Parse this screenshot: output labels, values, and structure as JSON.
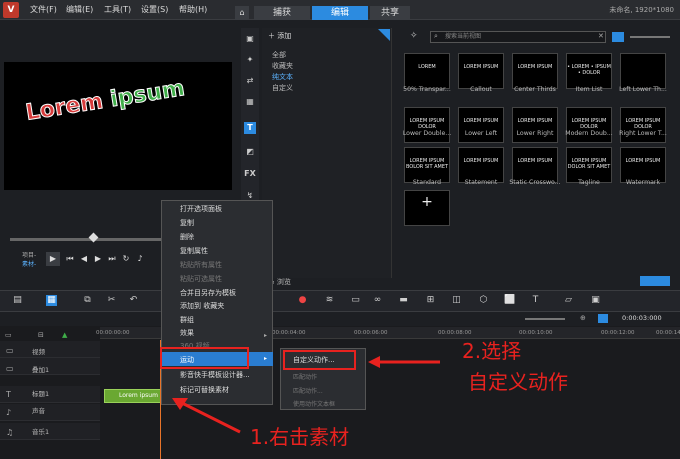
{
  "menubar": {
    "items": [
      "文件(F)",
      "编辑(E)",
      "工具(T)",
      "设置(S)",
      "帮助(H)"
    ]
  },
  "tabs": [
    "捕获",
    "编辑",
    "共享"
  ],
  "project_info": "未命名, 1920*1080",
  "preview": {
    "words": [
      "Lorem",
      " ",
      "ipsum"
    ],
    "colors": [
      "#d63a3a",
      "#f0d42b",
      "#3fae49",
      "#2f7ed8"
    ]
  },
  "playback": {
    "project_label": "项目-",
    "clip_label": "素材-"
  },
  "library": {
    "add_label": "添加",
    "categories": [
      "全部",
      "收藏夹",
      "纯文本",
      "自定义"
    ],
    "active_category": "纯文本",
    "search_placeholder": "搜索当前视图",
    "browse_label": "浏览",
    "thumbs": [
      {
        "label": "50% Transpar...",
        "text": "LOREM"
      },
      {
        "label": "Callout",
        "text": "LOREM IPSUM"
      },
      {
        "label": "Center Thirds",
        "text": "LOREM IPSUM"
      },
      {
        "label": "Item List",
        "text": "• LOREM • IPSUM • DOLOR"
      },
      {
        "label": "Left Lower Th...",
        "text": ""
      },
      {
        "label": "Lower Double...",
        "text": "LOREM IPSUM DOLOR"
      },
      {
        "label": "Lower Left",
        "text": "LOREM IPSUM"
      },
      {
        "label": "Lower Right",
        "text": "LOREM IPSUM"
      },
      {
        "label": "Modern Doub...",
        "text": "LOREM IPSUM DOLOR"
      },
      {
        "label": "Right Lower T...",
        "text": "LOREM IPSUM DOLOR"
      },
      {
        "label": "Standard",
        "text": "LOREM IPSUM BOLOR SIT AMET"
      },
      {
        "label": "Statement",
        "text": "LOREM IPSUM"
      },
      {
        "label": "Static Crosswo...",
        "text": "LOREM IPSUM"
      },
      {
        "label": "Tagline",
        "text": "LOREM IPSUM DOLOR SIT AMET"
      },
      {
        "label": "Watermark",
        "text": "LOREM IPSUM"
      }
    ],
    "add_thumb": "+"
  },
  "timeline": {
    "ruler": [
      "00:00:00:00",
      "00:00:02:00",
      "00:00:04:00",
      "00:00:06:00",
      "00:00:08:00",
      "00:00:10:00",
      "00:00:12:00",
      "00:00:14:00"
    ],
    "timecode": "0:00:03:000",
    "tracks": [
      "视频",
      "叠加1",
      "标题1",
      "声音",
      "音乐1"
    ],
    "clip_label": "Lorem ipsum"
  },
  "context_menu": {
    "items": [
      "打开选项面板",
      "复制",
      "删除",
      "复制属性",
      "粘贴所有属性",
      "粘贴可选属性",
      "合并目另存为模板",
      "添加到 收藏夹",
      "群组",
      "效果",
      "360 视频",
      "运动",
      "影音快手模板设计器...",
      "标记可替换素材"
    ],
    "disabled": [
      4,
      5,
      10
    ],
    "highlighted": "运动"
  },
  "submenu": {
    "items": [
      "自定义动作...",
      "匹配动作",
      "匹配动作...",
      "使用动作文本框"
    ],
    "disabled": [
      1,
      2,
      3
    ]
  },
  "annotations": {
    "step1": "1.右击素材",
    "step2_line1": "2.选择",
    "step2_line2": "自定义动作",
    "color": "#e8221f"
  }
}
